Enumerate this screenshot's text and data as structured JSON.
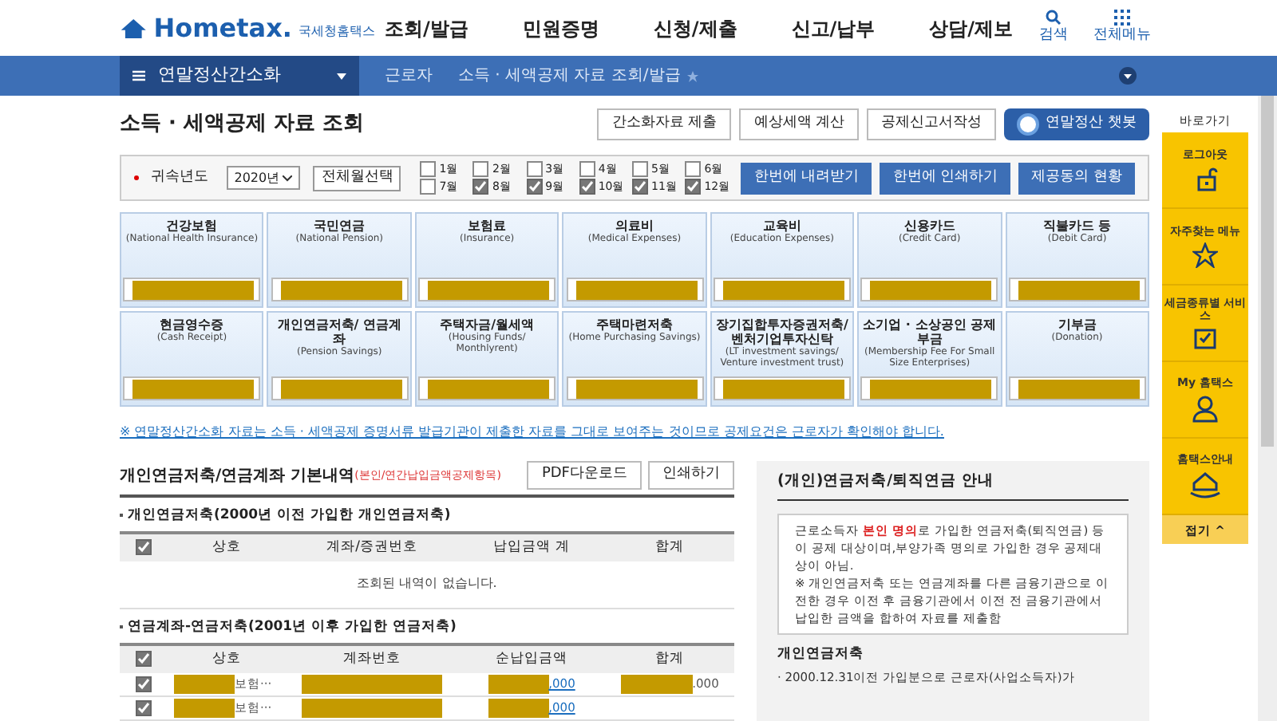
{
  "header": {
    "logo": "Hometax.",
    "logo_sub": "국세청홈택스",
    "menu": [
      "조회/발급",
      "민원증명",
      "신청/제출",
      "신고/납부",
      "상담/제보"
    ],
    "search": "검색",
    "all_menu": "전체메뉴"
  },
  "nav": {
    "section": "연말정산간소화",
    "crumbs": [
      "근로자",
      "소득 · 세액공제 자료 조회/발급"
    ]
  },
  "page_title": "소득 · 세액공제 자료 조회",
  "top_buttons": [
    {
      "label": "간소화자료 제출",
      "kind": "plain"
    },
    {
      "label": "예상세액 계산",
      "kind": "plain"
    },
    {
      "label": "공제신고서작성",
      "kind": "plain"
    },
    {
      "label": "연말정산 챗봇",
      "kind": "chatbot"
    }
  ],
  "filter": {
    "year_label": "귀속년도",
    "year": "2020년",
    "select_all": "전체월선택",
    "months": [
      {
        "label": "1월",
        "checked": false
      },
      {
        "label": "2월",
        "checked": false
      },
      {
        "label": "3월",
        "checked": false
      },
      {
        "label": "4월",
        "checked": false
      },
      {
        "label": "5월",
        "checked": false
      },
      {
        "label": "6월",
        "checked": false
      },
      {
        "label": "7월",
        "checked": false
      },
      {
        "label": "8월",
        "checked": true
      },
      {
        "label": "9월",
        "checked": true
      },
      {
        "label": "10월",
        "checked": true
      },
      {
        "label": "11월",
        "checked": true
      },
      {
        "label": "12월",
        "checked": true
      }
    ],
    "actions": [
      "한번에 내려받기",
      "한번에 인쇄하기",
      "제공동의 현황"
    ]
  },
  "cards": [
    {
      "title": "건강보험",
      "sub": "(National Health Insurance)"
    },
    {
      "title": "국민연금",
      "sub": "(National Pension)"
    },
    {
      "title": "보험료",
      "sub": "(Insurance)"
    },
    {
      "title": "의료비",
      "sub": "(Medical Expenses)"
    },
    {
      "title": "교육비",
      "sub": "(Education Expenses)"
    },
    {
      "title": "신용카드",
      "sub": "(Credit Card)"
    },
    {
      "title": "직불카드 등",
      "sub": "(Debit Card)"
    },
    {
      "title": "현금영수증",
      "sub": "(Cash Receipt)"
    },
    {
      "title": "개인연금저축/ 연금계좌",
      "sub": "(Pension Savings)"
    },
    {
      "title": "주택자금/월세액",
      "sub": "(Housing Funds/ Monthlyrent)"
    },
    {
      "title": "주택마련저축",
      "sub": "(Home Purchasing Savings)"
    },
    {
      "title": "장기집합투자증권저축/ 벤처기업투자신탁",
      "sub": "(LT investment savings/ Venture investment trust)"
    },
    {
      "title": "소기업 · 소상공인 공제부금",
      "sub": "(Membership Fee For Small Size Enterprises)"
    },
    {
      "title": "기부금",
      "sub": "(Donation)"
    }
  ],
  "notice": "※ 연말정산간소화 자료는 소득 · 세액공제 증명서류 발급기관이 제출한 자료를 그대로 보여주는 것이므로 공제요건은 근로자가 확인해야 합니다.",
  "left": {
    "title": "개인연금저축/연금계좌 기본내역",
    "title_note": "(본인/연간납입금액공제항목)",
    "buttons": [
      "PDF다운로드",
      "인쇄하기"
    ],
    "table1": {
      "caption": "개인연금저축(2000년 이전 가입한 개인연금저축)",
      "all_checked": true,
      "columns": [
        "상호",
        "계좌/증권번호",
        "납입금액 계",
        "합계"
      ],
      "empty": "조회된 내역이 없습니다."
    },
    "table2": {
      "caption": "연금계좌-연금저축(2001년 이후 가입한 연금저축)",
      "all_checked": true,
      "columns": [
        "상호",
        "계좌번호",
        "순납입금액",
        "합계"
      ],
      "rows": [
        {
          "checked": true,
          "company": "보험···",
          "amount": ",000",
          "total": ".000"
        },
        {
          "checked": true,
          "company": "보험···",
          "amount": ",000"
        }
      ]
    }
  },
  "right": {
    "title": "(개인)연금저축/퇴직연금 안내",
    "intro": [
      "근로소득자 ",
      "본인 명의",
      "로 가입한 연금저축(퇴직연금) 등이 공제 대상이며,부양가족 명의로 가입한 경우 공제대상이 아님."
    ],
    "note": "※ 개인연금저축 또는 연금계좌를 다른 금융기관으로 이전한 경우 이전 후 금융기관에서 이전 전 금융기관에서 납입한 금액을 합하여 자료를 제출함",
    "subhead": "개인연금저축",
    "bullet": "· 2000.12.31이전 가입분으로 근로자(사업소득자)가"
  },
  "quick": {
    "title": "바로가기",
    "items": [
      {
        "label": "로그아웃",
        "kind": "lock"
      },
      {
        "label": "자주찾는 메뉴",
        "kind": "star"
      },
      {
        "label": "세금종류별 서비스",
        "kind": "check"
      },
      {
        "label": "My 홈택스",
        "kind": "person"
      },
      {
        "label": "홈택스안내",
        "kind": "house"
      }
    ],
    "fold": "접기 ^"
  }
}
